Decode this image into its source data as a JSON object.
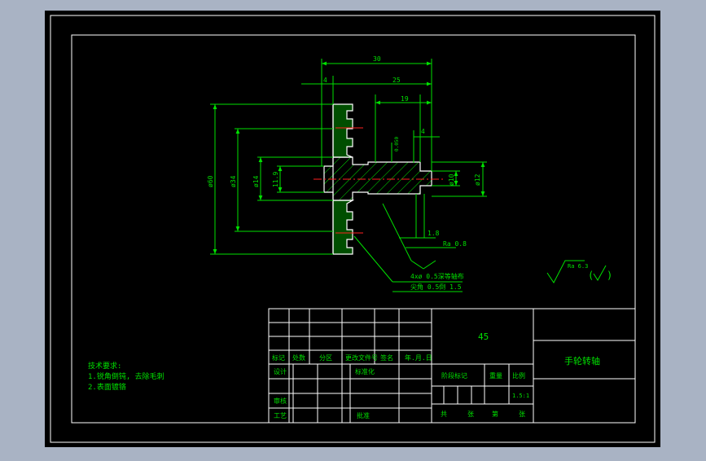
{
  "colors": {
    "background": "#a9b3c4",
    "sheet": "#000000",
    "line": "#ffffff",
    "dimension": "#00e000",
    "hatch": "#00e000",
    "centerline": "#ff2020",
    "part_outline": "#ffffff"
  },
  "drawing": {
    "dims": {
      "top_overall": "30",
      "top_small": "4",
      "top_mid": "25",
      "top_hub": "19",
      "right_small": "4",
      "right_tol": "0.050",
      "phi60": "ø60",
      "phi34": "ø34",
      "phi14": "ø14",
      "phi11_9": "11.9",
      "phi10": "ø10",
      "phi12": "ø12",
      "len_1_8": "1.8",
      "ra_small": "Ra 0.8",
      "ann_depth": "4xø 0.5深等轴布",
      "ann_chamfer": "尖角 0.5倒 1.5"
    },
    "roughness": {
      "ra_value": "Ra 6.3",
      "paren_open": "(",
      "paren_close": ")"
    },
    "tech_requirements": {
      "title": "技术要求:",
      "line1": "1.锐角倒钝, 去除毛刺",
      "line2": "2.表面镀铬"
    },
    "title_block": {
      "material": "45",
      "part_name": "手轮转轴",
      "row_labels": [
        "标记",
        "处数",
        "分区",
        "更改文件号",
        "签名",
        "年.月.日"
      ],
      "designer": "设计",
      "standardization": "标准化",
      "checker": "审核",
      "process": "工艺",
      "approver": "批准",
      "stage_mark": "阶段标记",
      "weight": "重量",
      "scale": "比例",
      "scale_value": "1.5:1",
      "sheet_total": "共",
      "sheet_unit1": "张",
      "sheet_no": "第",
      "sheet_unit2": "张"
    }
  }
}
